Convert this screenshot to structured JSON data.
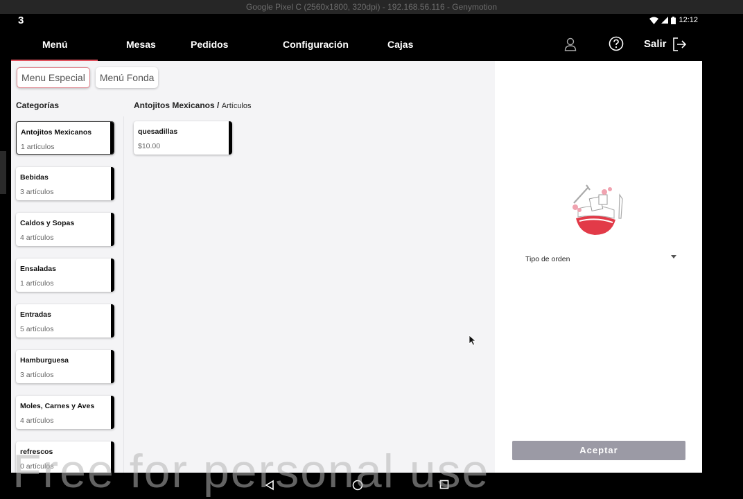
{
  "window_title": "Google Pixel C (2560x1800, 320dpi) - 192.168.56.116 - Genymotion",
  "status": {
    "logo": "3",
    "time": "12:12"
  },
  "nav": {
    "items": [
      {
        "label": "Menú"
      },
      {
        "label": "Mesas"
      },
      {
        "label": "Pedidos"
      },
      {
        "label": "Configuración"
      },
      {
        "label": "Cajas"
      }
    ],
    "logout": "Salir",
    "active_color": "#e0525e"
  },
  "menu_tabs": [
    "Menu Especial",
    "Menú Fonda"
  ],
  "categories_heading": "Categorías",
  "categories": [
    {
      "name": "Antojitos Mexicanos",
      "count": "1 artículos"
    },
    {
      "name": "Bebidas",
      "count": "3 artículos"
    },
    {
      "name": "Caldos y Sopas",
      "count": "4 artículos"
    },
    {
      "name": "Ensaladas",
      "count": "1 artículos"
    },
    {
      "name": "Entradas",
      "count": "5 artículos"
    },
    {
      "name": "Hamburguesa",
      "count": "3 artículos"
    },
    {
      "name": "Moles, Carnes y Aves",
      "count": "4 artículos"
    },
    {
      "name": "refrescos",
      "count": "0 artículos"
    }
  ],
  "breadcrumb": {
    "category": "Antojitos Mexicanos",
    "separator": " / ",
    "section": "Artículos"
  },
  "products": [
    {
      "name": "quesadillas",
      "price": "$10.00"
    }
  ],
  "order": {
    "type_label": "Tipo de orden",
    "accept_label": "Aceptar",
    "accept_color": "#9b9aa5"
  },
  "watermark": "Free for personal use",
  "icons": {
    "user": "user-icon",
    "help": "help-icon",
    "logout": "logout-icon"
  }
}
